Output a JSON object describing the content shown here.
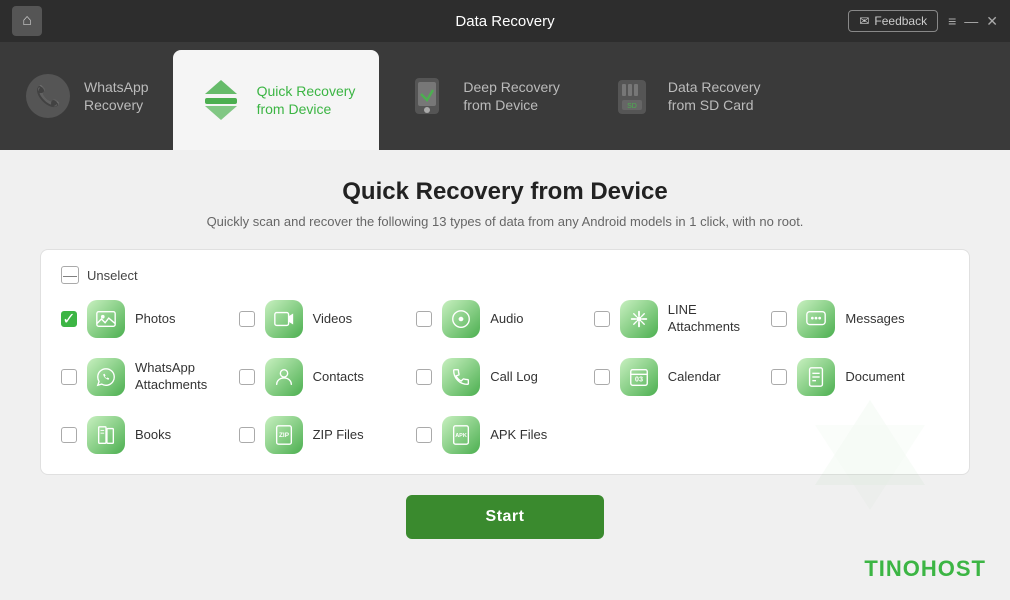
{
  "titleBar": {
    "title": "Data Recovery",
    "homeIcon": "🏠",
    "feedbackLabel": "Feedback",
    "feedbackIcon": "✉",
    "menuIcon": "≡",
    "minimizeIcon": "—",
    "closeIcon": "✕"
  },
  "nav": {
    "tabs": [
      {
        "id": "whatsapp",
        "label": "WhatsApp\nRecovery",
        "active": false,
        "icon": "📞"
      },
      {
        "id": "quick",
        "label": "Quick Recovery\nfrom Device",
        "active": true,
        "icon": "📦"
      },
      {
        "id": "deep",
        "label": "Deep Recovery\nfrom Device",
        "active": false,
        "icon": "📱"
      },
      {
        "id": "sdcard",
        "label": "Data Recovery\nfrom SD Card",
        "active": false,
        "icon": "💾"
      }
    ]
  },
  "main": {
    "title": "Quick Recovery from Device",
    "subtitle": "Quickly scan and recover the following 13 types of data from any Android models in 1 click, with no root.",
    "panel": {
      "unselect": "Unselect",
      "items": [
        {
          "id": "photos",
          "label": "Photos",
          "checked": true,
          "iconText": "🖼"
        },
        {
          "id": "videos",
          "label": "Videos",
          "checked": false,
          "iconText": "▶"
        },
        {
          "id": "audio",
          "label": "Audio",
          "checked": false,
          "iconText": "♪"
        },
        {
          "id": "line",
          "label": "LINE\nAttachments",
          "checked": false,
          "iconText": "📎"
        },
        {
          "id": "messages",
          "label": "Messages",
          "checked": false,
          "iconText": "💬"
        },
        {
          "id": "whatsapp",
          "label": "WhatsApp\nAttachments",
          "checked": false,
          "iconText": "🔗"
        },
        {
          "id": "contacts",
          "label": "Contacts",
          "checked": false,
          "iconText": "👤"
        },
        {
          "id": "calllog",
          "label": "Call Log",
          "checked": false,
          "iconText": "📞"
        },
        {
          "id": "calendar",
          "label": "Calendar",
          "checked": false,
          "iconText": "📅"
        },
        {
          "id": "document",
          "label": "Document",
          "checked": false,
          "iconText": "📄"
        },
        {
          "id": "books",
          "label": "Books",
          "checked": false,
          "iconText": "📚"
        },
        {
          "id": "zip",
          "label": "ZIP Files",
          "checked": false,
          "iconText": "🗜"
        },
        {
          "id": "apk",
          "label": "APK Files",
          "checked": false,
          "iconText": "📦"
        }
      ]
    },
    "startButton": "Start"
  },
  "watermark": {
    "prefix": "TINO",
    "suffix": "HOST"
  }
}
